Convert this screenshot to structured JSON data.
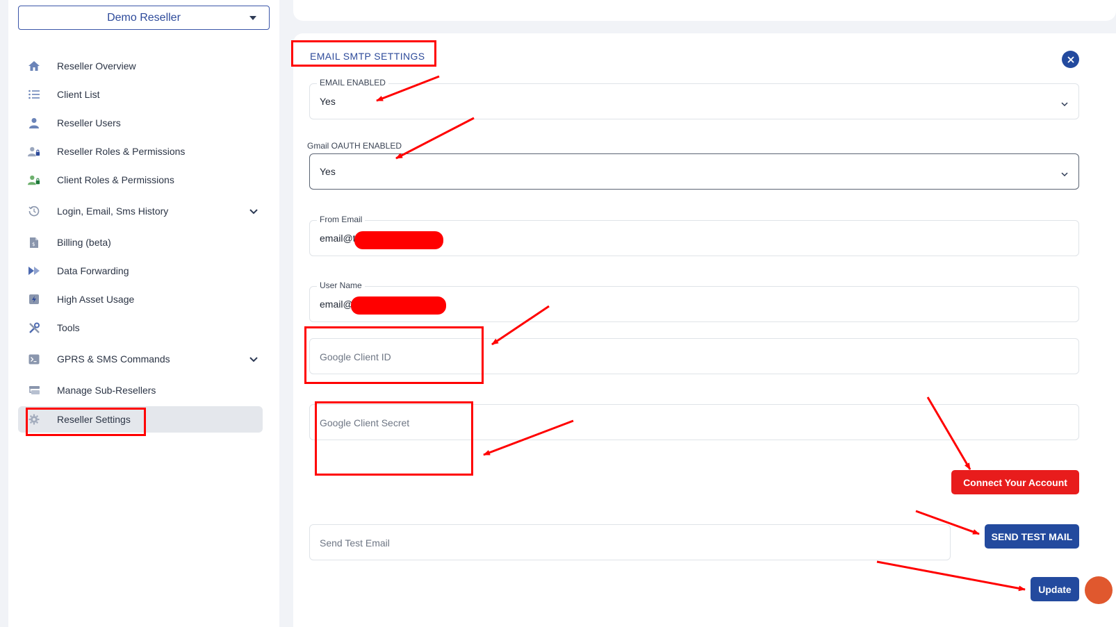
{
  "sidebar": {
    "reseller_select": "Demo Reseller",
    "items": [
      {
        "label": "Reseller Overview",
        "icon": "home-icon"
      },
      {
        "label": "Client List",
        "icon": "list-icon"
      },
      {
        "label": "Reseller Users",
        "icon": "users-icon"
      },
      {
        "label": "Reseller Roles & Permissions",
        "icon": "user-lock-icon"
      },
      {
        "label": "Client Roles & Permissions",
        "icon": "user-lock-green-icon"
      },
      {
        "label": "Login, Email, Sms History",
        "icon": "history-icon"
      },
      {
        "label": "Billing (beta)",
        "icon": "invoice-icon"
      },
      {
        "label": "Data Forwarding",
        "icon": "forward-icon"
      },
      {
        "label": "High Asset Usage",
        "icon": "bolt-icon"
      },
      {
        "label": "Tools",
        "icon": "tools-icon"
      },
      {
        "label": "GPRS & SMS Commands",
        "icon": "terminal-icon"
      },
      {
        "label": "Manage Sub-Resellers",
        "icon": "sub-reseller-icon"
      },
      {
        "label": "Reseller Settings",
        "icon": "gear-icon"
      }
    ]
  },
  "main": {
    "section_title": "EMAIL SMTP SETTINGS",
    "email_enabled": {
      "label": "EMAIL ENABLED",
      "value": "Yes"
    },
    "gmail_oauth": {
      "label": "Gmail OAUTH ENABLED",
      "value": "Yes"
    },
    "from_email": {
      "label": "From Email",
      "value": "email@t"
    },
    "user_name": {
      "label": "User Name",
      "value": "email@"
    },
    "google_client_id": {
      "placeholder": "Google Client ID"
    },
    "google_client_secret": {
      "placeholder": "Google Client Secret"
    },
    "connect_button": "Connect Your Account",
    "send_test_email": {
      "placeholder": "Send Test Email"
    },
    "send_test_button": "SEND TEST MAIL",
    "update_button": "Update"
  },
  "colors": {
    "primary": "#234a9e",
    "danger": "#e81c1c",
    "annotation": "#ff0000"
  }
}
